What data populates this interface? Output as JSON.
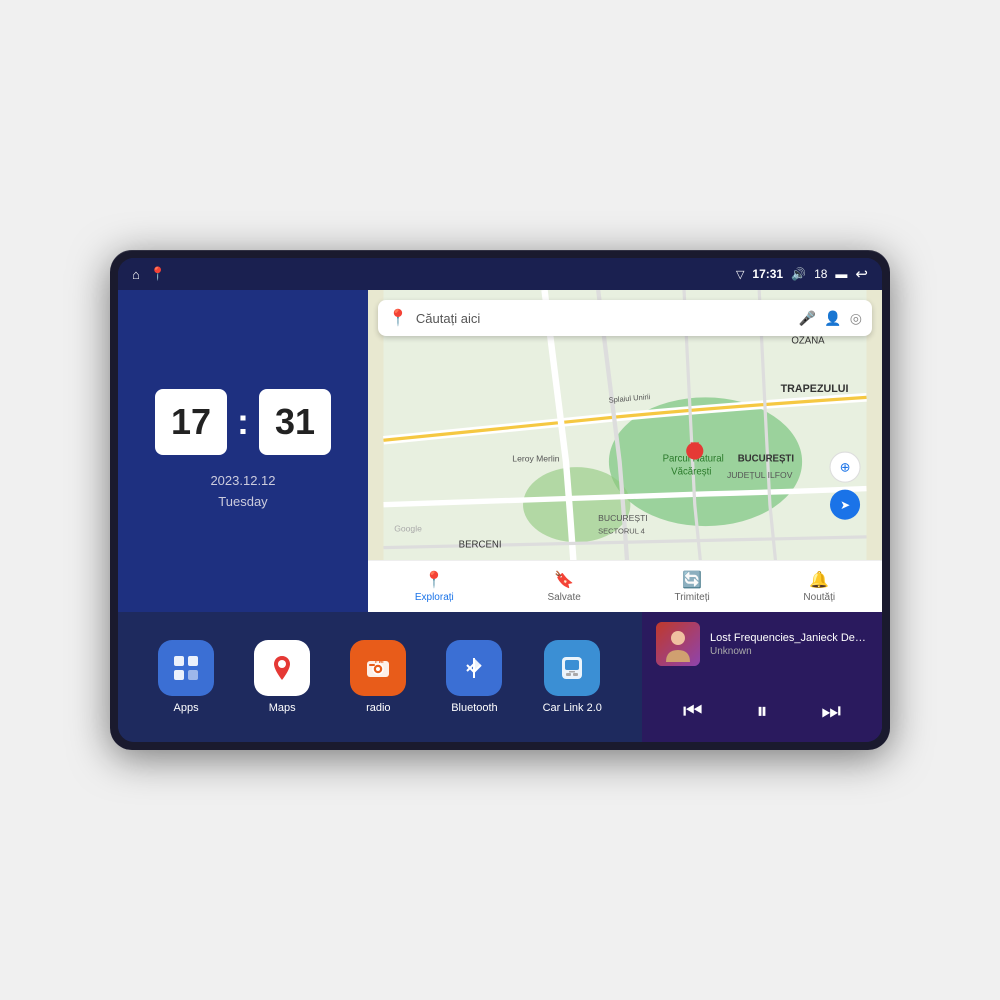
{
  "device": {
    "status_bar": {
      "left_icons": [
        "home-icon",
        "maps-pin-icon"
      ],
      "signal_icon": "▽",
      "time": "17:31",
      "volume_icon": "🔊",
      "battery_level": "18",
      "battery_icon": "🔋",
      "back_icon": "↩"
    },
    "clock": {
      "hours": "17",
      "minutes": "31",
      "date": "2023.12.12",
      "day": "Tuesday"
    },
    "map": {
      "search_placeholder": "Căutați aici",
      "nav_items": [
        {
          "label": "Explorați",
          "icon": "📍",
          "active": true
        },
        {
          "label": "Salvate",
          "icon": "🔖",
          "active": false
        },
        {
          "label": "Trimiteți",
          "icon": "🔄",
          "active": false
        },
        {
          "label": "Noutăți",
          "icon": "🔔",
          "active": false
        }
      ]
    },
    "apps": [
      {
        "id": "apps",
        "label": "Apps",
        "icon": "⊞",
        "color": "#3b6fd4"
      },
      {
        "id": "maps",
        "label": "Maps",
        "icon": "🗺",
        "color": "#fff"
      },
      {
        "id": "radio",
        "label": "radio",
        "icon": "📻",
        "color": "#e85c1a"
      },
      {
        "id": "bluetooth",
        "label": "Bluetooth",
        "icon": "🔵",
        "color": "#3b6fd4"
      },
      {
        "id": "carlink",
        "label": "Car Link 2.0",
        "icon": "📱",
        "color": "#3b8fd4"
      }
    ],
    "music": {
      "title": "Lost Frequencies_Janieck Devy-...",
      "artist": "Unknown",
      "controls": {
        "prev": "⏮",
        "play_pause": "⏸",
        "next": "⏭"
      }
    }
  }
}
